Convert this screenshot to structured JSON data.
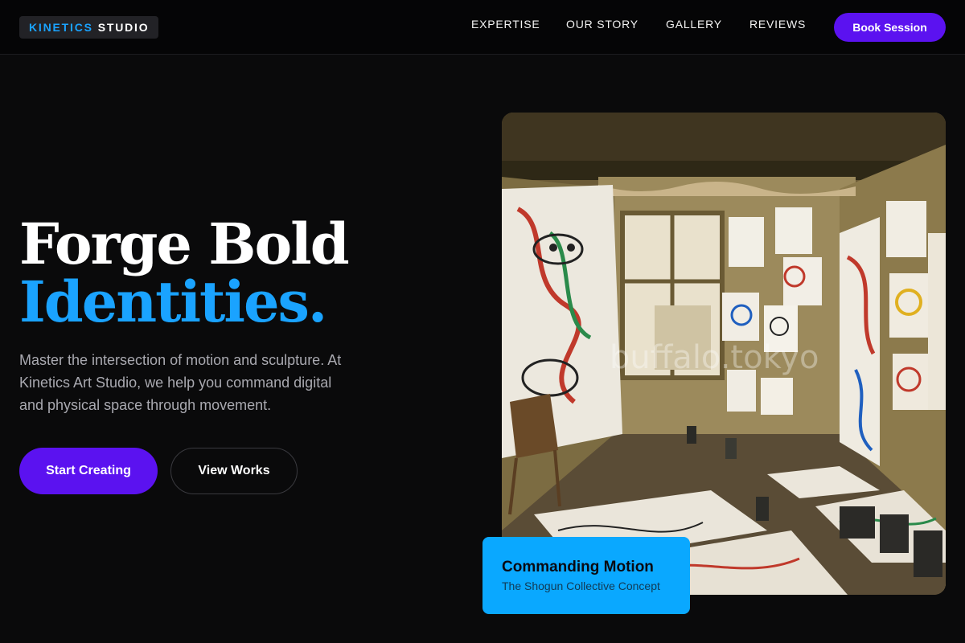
{
  "brand": {
    "accent": "KINETICS",
    "rest": "STUDIO"
  },
  "nav": {
    "links": [
      "EXPERTISE",
      "OUR STORY",
      "GALLERY",
      "REVIEWS"
    ],
    "cta": "Book Session"
  },
  "hero": {
    "headline_line1": "Forge Bold",
    "headline_line2": "Identities.",
    "description_lines": [
      "Master the intersection of motion and sculpture. At",
      "Kinetics Art Studio, we help you command digital",
      "and physical space through movement."
    ],
    "primary_cta": "Start Creating",
    "secondary_cta": "View Works"
  },
  "feature_card": {
    "title": "Commanding Motion",
    "subtitle": "The Shogun Collective Concept"
  },
  "image": {
    "watermark": "buffalo.tokyo"
  },
  "colors": {
    "background": "#0a0a0b",
    "accent_blue": "#1aa3ff",
    "accent_purple": "#5b12f0",
    "card_blue": "#0aa8ff"
  }
}
